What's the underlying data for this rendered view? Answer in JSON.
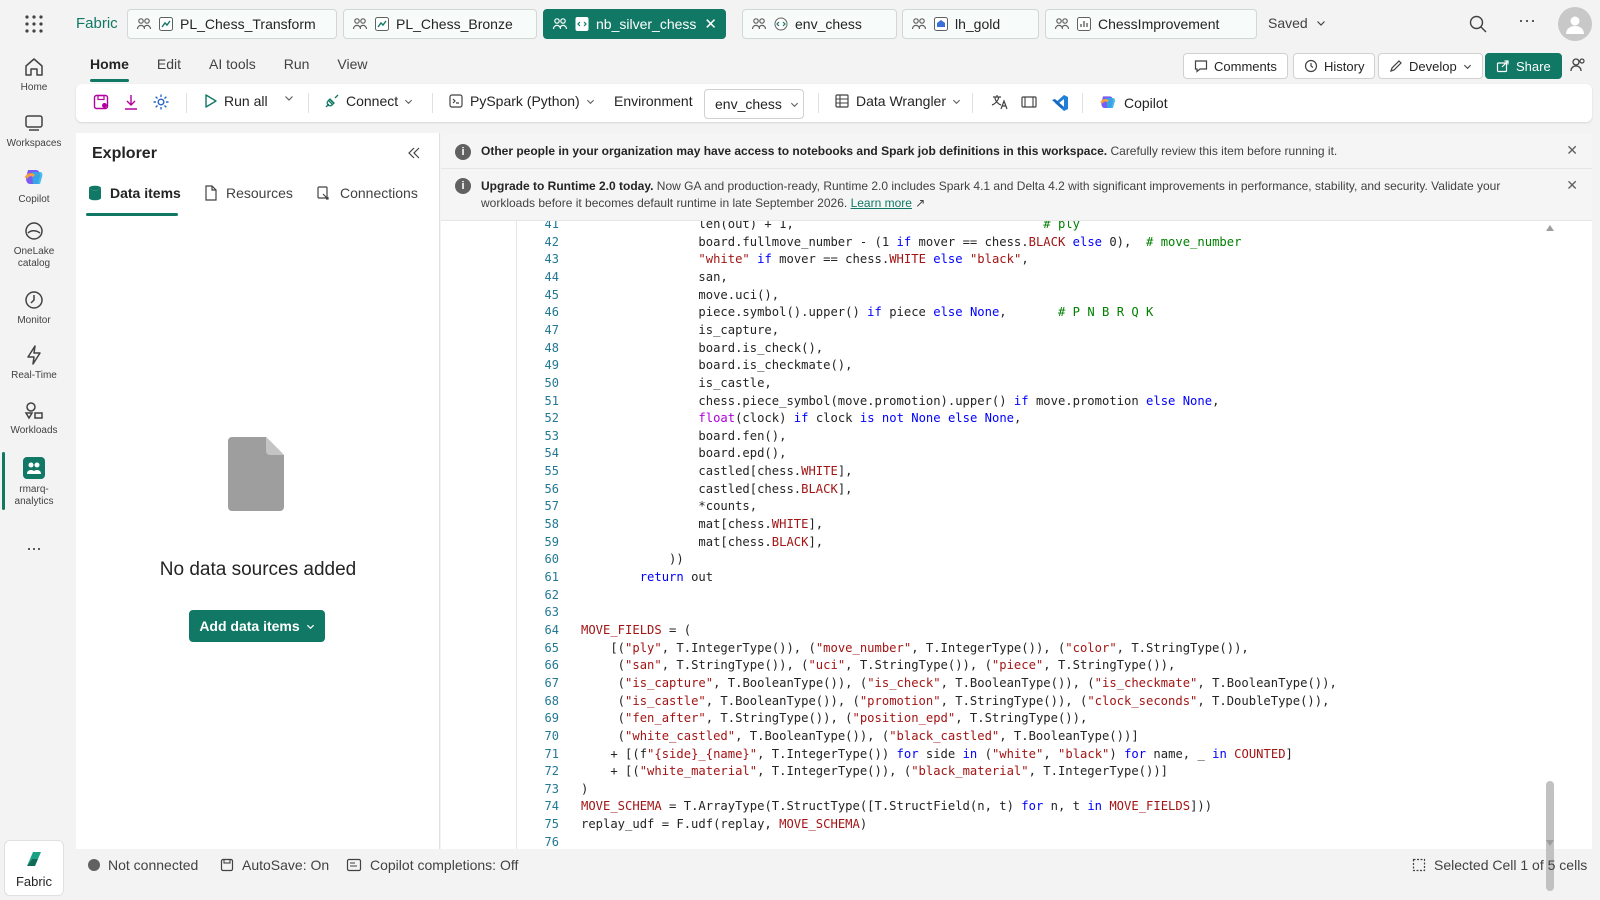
{
  "app": {
    "name": "Fabric"
  },
  "tabs": [
    {
      "label": "PL_Chess_Transform",
      "type": "pipeline"
    },
    {
      "label": "PL_Chess_Bronze",
      "type": "pipeline"
    },
    {
      "label": "nb_silver_chess",
      "type": "notebook",
      "active": true
    },
    {
      "label": "env_chess",
      "type": "environment"
    },
    {
      "label": "lh_gold",
      "type": "lakehouse"
    },
    {
      "label": "ChessImprovement",
      "type": "report"
    }
  ],
  "topbar": {
    "saved_label": "Saved"
  },
  "rail": {
    "items": [
      {
        "label": "Home",
        "icon": "home-icon"
      },
      {
        "label": "Workspaces",
        "icon": "workspaces-icon"
      },
      {
        "label": "Copilot",
        "icon": "copilot-icon"
      },
      {
        "label": "OneLake catalog",
        "icon": "onelake-icon"
      },
      {
        "label": "Monitor",
        "icon": "monitor-icon"
      },
      {
        "label": "Real-Time",
        "icon": "realtime-icon"
      },
      {
        "label": "Workloads",
        "icon": "workloads-icon"
      },
      {
        "label": "rmarq-analytics",
        "icon": "workspace-icon"
      }
    ],
    "more": "...",
    "fabric_label": "Fabric"
  },
  "ribbon": {
    "tabs": [
      "Home",
      "Edit",
      "AI tools",
      "Run",
      "View"
    ],
    "active_tab": "Home",
    "comments": "Comments",
    "history": "History",
    "develop": "Develop",
    "share": "Share"
  },
  "toolbar": {
    "run_all": "Run all",
    "connect": "Connect",
    "language": "PySpark (Python)",
    "environment_label": "Environment",
    "environment_value": "env_chess",
    "data_wrangler": "Data Wrangler",
    "copilot": "Copilot"
  },
  "explorer": {
    "title": "Explorer",
    "tabs": [
      "Data items",
      "Resources",
      "Connections"
    ],
    "empty_text": "No data sources added",
    "add_button": "Add data items"
  },
  "banners": [
    {
      "bold": "Other people in your organization may have access to notebooks and Spark job definitions in this workspace.",
      "text": " Carefully review this item before running it."
    },
    {
      "bold": "Upgrade to Runtime 2.0 today.",
      "text": " Now GA and production-ready, Runtime 2.0 includes Spark 4.1 and Delta 4.2 with significant improvements in performance, stability, and security. Validate your workloads before it becomes default runtime in late September 2026.",
      "link": "Learn more"
    }
  ],
  "code": {
    "line_numbers": [
      "41",
      "42",
      "43",
      "44",
      "45",
      "46",
      "47",
      "48",
      "49",
      "50",
      "51",
      "52",
      "53",
      "54",
      "55",
      "56",
      "57",
      "58",
      "59",
      "60",
      "61",
      "62",
      "63",
      "64",
      "65",
      "66",
      "67",
      "68",
      "69",
      "70",
      "71",
      "72",
      "73",
      "74",
      "75",
      "76"
    ],
    "lines": [
      "                len(out) + 1,                                  # ply",
      "                board.fullmove_number - (1 if mover == chess.BLACK else 0),  # move_number",
      "                \"white\" if mover == chess.WHITE else \"black\",",
      "                san,",
      "                move.uci(),",
      "                piece.symbol().upper() if piece else None,       # P N B R Q K",
      "                is_capture,",
      "                board.is_check(),",
      "                board.is_checkmate(),",
      "                is_castle,",
      "                chess.piece_symbol(move.promotion).upper() if move.promotion else None,",
      "                float(clock) if clock is not None else None,",
      "                board.fen(),",
      "                board.epd(),",
      "                castled[chess.WHITE],",
      "                castled[chess.BLACK],",
      "                *counts,",
      "                mat[chess.WHITE],",
      "                mat[chess.BLACK],",
      "            ))",
      "        return out",
      "",
      "",
      "MOVE_FIELDS = (",
      "    [(\"ply\", T.IntegerType()), (\"move_number\", T.IntegerType()), (\"color\", T.StringType()),",
      "     (\"san\", T.StringType()), (\"uci\", T.StringType()), (\"piece\", T.StringType()),",
      "     (\"is_capture\", T.BooleanType()), (\"is_check\", T.BooleanType()), (\"is_checkmate\", T.BooleanType()),",
      "     (\"is_castle\", T.BooleanType()), (\"promotion\", T.StringType()), (\"clock_seconds\", T.DoubleType()),",
      "     (\"fen_after\", T.StringType()), (\"position_epd\", T.StringType()),",
      "     (\"white_castled\", T.BooleanType()), (\"black_castled\", T.BooleanType())]",
      "    + [(f\"{side}_{name}\", T.IntegerType()) for side in (\"white\", \"black\") for name, _ in COUNTED]",
      "    + [(\"white_material\", T.IntegerType()), (\"black_material\", T.IntegerType())]",
      ")",
      "MOVE_SCHEMA = T.ArrayType(T.StructType([T.StructField(n, t) for n, t in MOVE_FIELDS]))",
      "replay_udf = F.udf(replay, MOVE_SCHEMA)",
      ""
    ]
  },
  "status": {
    "connection": "Not connected",
    "autosave": "AutoSave: On",
    "copilot_completions": "Copilot completions: Off",
    "selection": "Selected Cell 1 of 5 cells"
  },
  "colors": {
    "accent": "#117865",
    "line_number": "#237893",
    "keyword": "#0000ff",
    "string": "#a31515",
    "comment": "#008000"
  }
}
